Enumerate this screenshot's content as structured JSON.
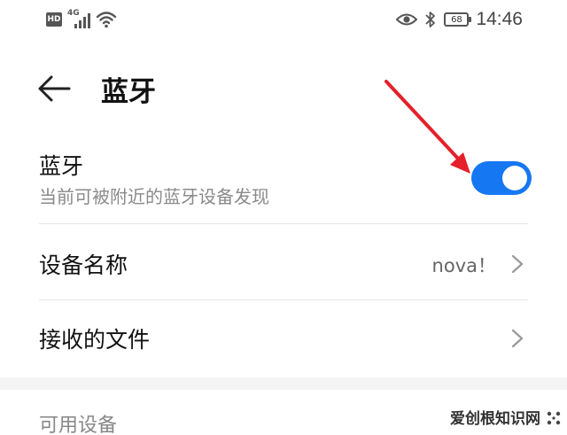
{
  "status_bar": {
    "hd_label": "HD",
    "network_label": "4G",
    "battery": "68",
    "time": "14:46",
    "icons": [
      "hd-icon",
      "signal-icon",
      "wifi-icon",
      "eye-icon",
      "bluetooth-icon",
      "battery-icon"
    ]
  },
  "header": {
    "back_icon": "arrow-left-icon",
    "title": "蓝牙"
  },
  "bluetooth": {
    "label": "蓝牙",
    "subtitle": "当前可被附近的蓝牙设备发现",
    "enabled": true,
    "accent_color": "#1677f2"
  },
  "settings": [
    {
      "label": "设备名称",
      "value": "nova！"
    },
    {
      "label": "接收的文件",
      "value": ""
    }
  ],
  "section": {
    "title": "可用设备"
  },
  "annotation": {
    "arrow_color": "#e5202a"
  },
  "watermark": {
    "text": "爱创根知识网"
  }
}
